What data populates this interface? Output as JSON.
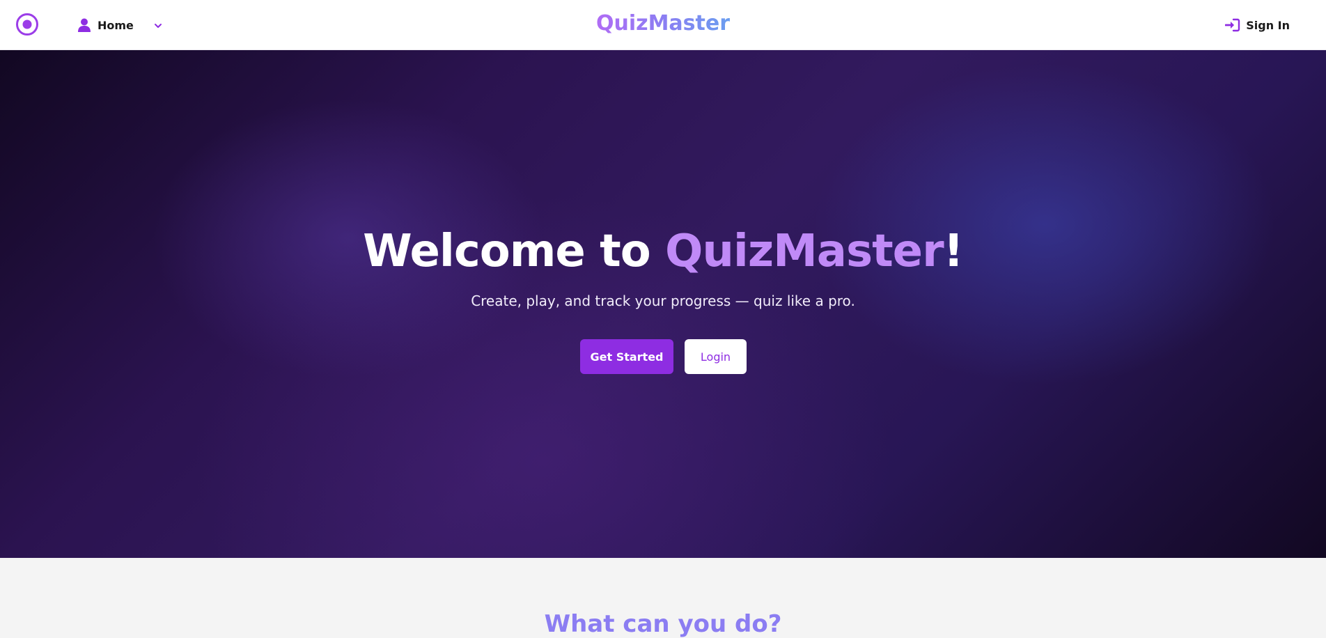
{
  "nav": {
    "home_label": "Home",
    "brand": "QuizMaster",
    "signin_label": "Sign In"
  },
  "hero": {
    "title_prefix": "Welcome to ",
    "title_accent": "QuizMaster",
    "title_suffix": "!",
    "subtitle": "Create, play, and track your progress — quiz like a pro.",
    "primary_button": "Get Started",
    "secondary_button": "Login"
  },
  "features": {
    "title": "What can you do?"
  },
  "icons": {
    "logo": "record-circle-icon",
    "home": "person-icon",
    "dropdown": "chevron-down-icon",
    "signin": "sign-in-icon"
  },
  "colors": {
    "accent": "#8e2de2",
    "accent_light": "#c08af7",
    "brand_gradient_start": "#b06cf5",
    "brand_gradient_end": "#6a9ef0",
    "hero_dark": "#120822"
  }
}
